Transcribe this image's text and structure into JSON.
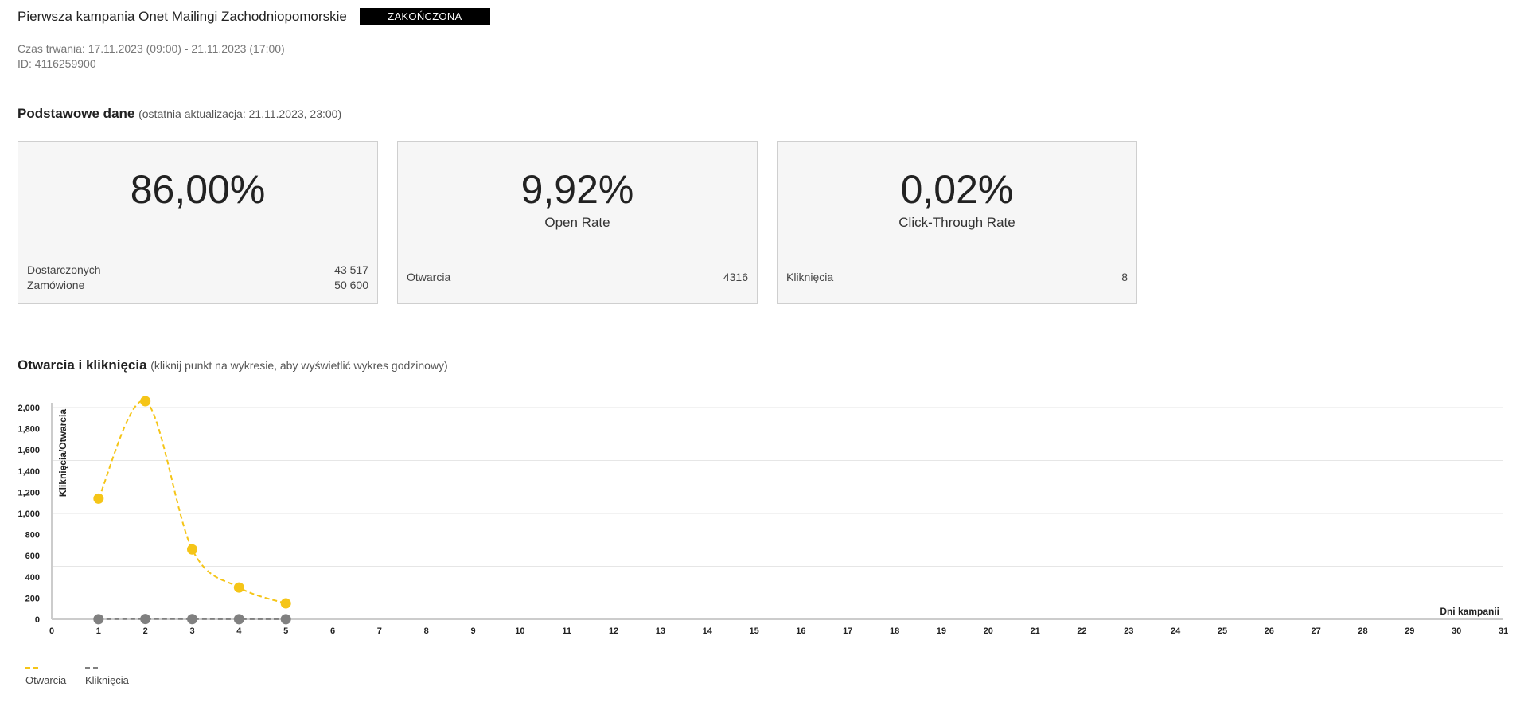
{
  "header": {
    "title": "Pierwsza kampania Onet Mailingi Zachodniopomorskie",
    "status": "ZAKOŃCZONA"
  },
  "meta": {
    "duration": "Czas trwania: 17.11.2023 (09:00) - 21.11.2023 (17:00)",
    "id": "ID: 4116259900"
  },
  "basic": {
    "title": "Podstawowe dane",
    "note": "(ostatnia aktualizacja: 21.11.2023, 23:00)"
  },
  "cards": [
    {
      "value": "86,00%",
      "label": "",
      "rows": [
        {
          "label": "Dostarczonych",
          "value": "43 517"
        },
        {
          "label": "Zamówione",
          "value": "50 600"
        }
      ]
    },
    {
      "value": "9,92%",
      "label": "Open Rate",
      "rows": [
        {
          "label": "Otwarcia",
          "value": "4316"
        }
      ]
    },
    {
      "value": "0,02%",
      "label": "Click-Through Rate",
      "rows": [
        {
          "label": "Kliknięcia",
          "value": "8"
        }
      ]
    }
  ],
  "chart_section": {
    "title": "Otwarcia i kliknięcia",
    "note": "(kliknij punkt na wykresie, aby wyświetlić wykres godzinowy)"
  },
  "chart_data": {
    "type": "line",
    "xlabel": "Dni kampanii",
    "ylabel": "Kliknięcia/Otwarcia",
    "xlim": [
      0,
      31
    ],
    "ylim": [
      0,
      2000
    ],
    "x_ticks": [
      0,
      1,
      2,
      3,
      4,
      5,
      6,
      7,
      8,
      9,
      10,
      11,
      12,
      13,
      14,
      15,
      16,
      17,
      18,
      19,
      20,
      21,
      22,
      23,
      24,
      25,
      26,
      27,
      28,
      29,
      30,
      31
    ],
    "y_ticks": [
      0,
      200,
      400,
      600,
      800,
      1000,
      1200,
      1400,
      1600,
      1800,
      2000
    ],
    "y_tick_labels": [
      "0",
      "200",
      "400",
      "600",
      "800",
      "1,000",
      "1,200",
      "1,400",
      "1,600",
      "1,800",
      "2,000"
    ],
    "grid": true,
    "legend_position": "bottom-left",
    "series": [
      {
        "name": "Otwarcia",
        "color": "#f5c518",
        "x": [
          1,
          2,
          3,
          4,
          5
        ],
        "values": [
          1140,
          2060,
          660,
          300,
          150
        ]
      },
      {
        "name": "Kliknięcia",
        "color": "#808080",
        "x": [
          1,
          2,
          3,
          4,
          5
        ],
        "values": [
          1,
          3,
          2,
          1,
          1
        ]
      }
    ]
  }
}
